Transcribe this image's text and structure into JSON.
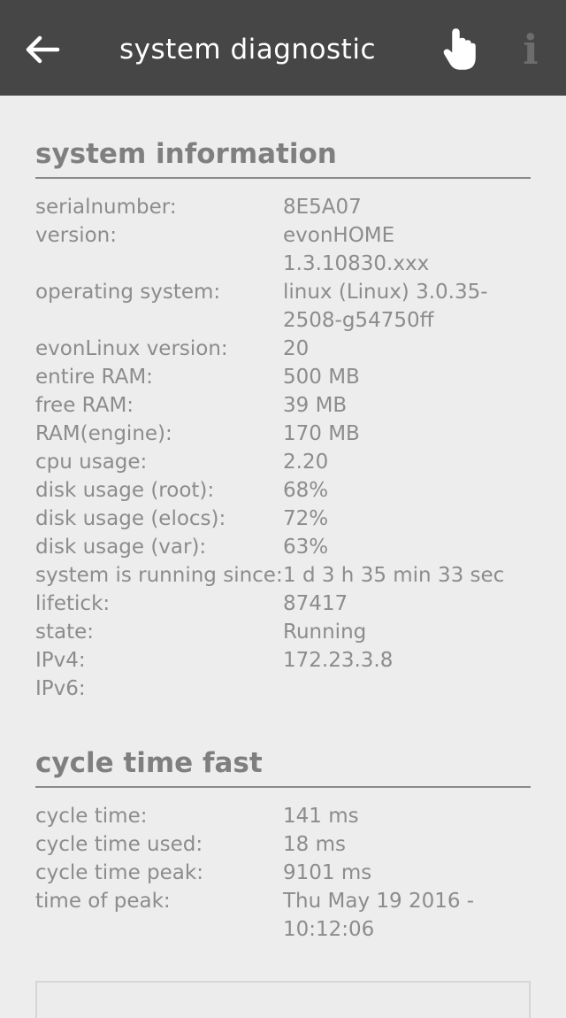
{
  "header": {
    "title": "system diagnostic",
    "back_icon": "arrow-left-icon",
    "hand_icon": "hand-pointer-icon",
    "info_icon": "info-icon",
    "info_glyph": "i"
  },
  "system_information": {
    "title": "system information",
    "rows": [
      {
        "label": "serialnumber:",
        "value": "8E5A07"
      },
      {
        "label": "version:",
        "value": "evonHOME 1.3.10830.xxx"
      },
      {
        "label": "operating system:",
        "value": "linux (Linux) 3.0.35-2508-g54750ff"
      },
      {
        "label": "evonLinux version:",
        "value": "20"
      },
      {
        "label": "entire RAM:",
        "value": "500 MB"
      },
      {
        "label": "free RAM:",
        "value": "39 MB"
      },
      {
        "label": "RAM(engine):",
        "value": "170 MB"
      },
      {
        "label": "cpu usage:",
        "value": "2.20"
      },
      {
        "label": "disk usage (root):",
        "value": "68%"
      },
      {
        "label": "disk usage (elocs):",
        "value": "72%"
      },
      {
        "label": "disk usage (var):",
        "value": "63%"
      },
      {
        "label": "system is running since:",
        "value": "1 d 3 h 35 min 33 sec"
      },
      {
        "label": "lifetick:",
        "value": "87417"
      },
      {
        "label": "state:",
        "value": "Running"
      },
      {
        "label": "IPv4:",
        "value": "172.23.3.8"
      },
      {
        "label": "IPv6:",
        "value": ""
      }
    ]
  },
  "cycle_time_fast": {
    "title": "cycle time fast",
    "rows": [
      {
        "label": "cycle time:",
        "value": "141 ms"
      },
      {
        "label": "cycle time used:",
        "value": "18 ms"
      },
      {
        "label": "cycle time peak:",
        "value": "9101 ms"
      },
      {
        "label": "time of peak:",
        "value": "Thu May 19 2016 - 10:12:06"
      }
    ]
  },
  "colors": {
    "header_bg": "#464646",
    "page_bg": "#ededed",
    "text": "#8c8c8c"
  }
}
